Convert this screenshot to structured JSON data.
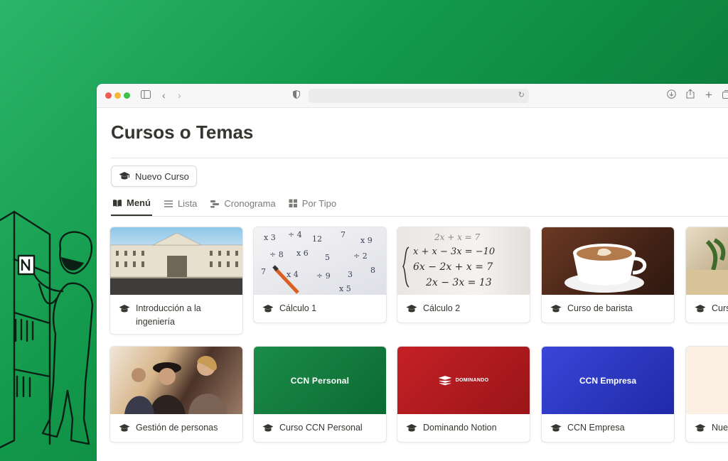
{
  "page": {
    "title": "Cursos o Temas",
    "new_button": "Nuevo Curso",
    "tabs": [
      {
        "label": "Menú",
        "icon": "book-icon"
      },
      {
        "label": "Lista",
        "icon": "list-icon"
      },
      {
        "label": "Cronograma",
        "icon": "timeline-icon"
      },
      {
        "label": "Por Tipo",
        "icon": "board-icon"
      }
    ]
  },
  "cards_row1": [
    {
      "label": "Introducción a la ingeniería",
      "image": "palace-photo"
    },
    {
      "label": "Cálculo 1",
      "image": "math-paper-photo"
    },
    {
      "label": "Cálculo 2",
      "image": "equations-photo"
    },
    {
      "label": "Curso de barista",
      "image": "coffee-photo"
    },
    {
      "label": "Curs",
      "image": "plant-photo"
    }
  ],
  "cards_row2": [
    {
      "label": "Gestión de personas",
      "image": "people-photo"
    },
    {
      "label": "Curso CCN Personal",
      "cover_text": "CCN Personal",
      "cover_color": "#137a3d"
    },
    {
      "label": "Dominando Notion",
      "cover_text": "DOMINANDO",
      "cover_color": "#b81f22"
    },
    {
      "label": "CCN Empresa",
      "cover_text": "CCN Empresa",
      "cover_color": "#2a39c7"
    },
    {
      "label": "Nue",
      "cover_color": "#fcefe3"
    }
  ],
  "colors": {
    "background_green": "#139a4c",
    "text_dark": "#37352f"
  }
}
